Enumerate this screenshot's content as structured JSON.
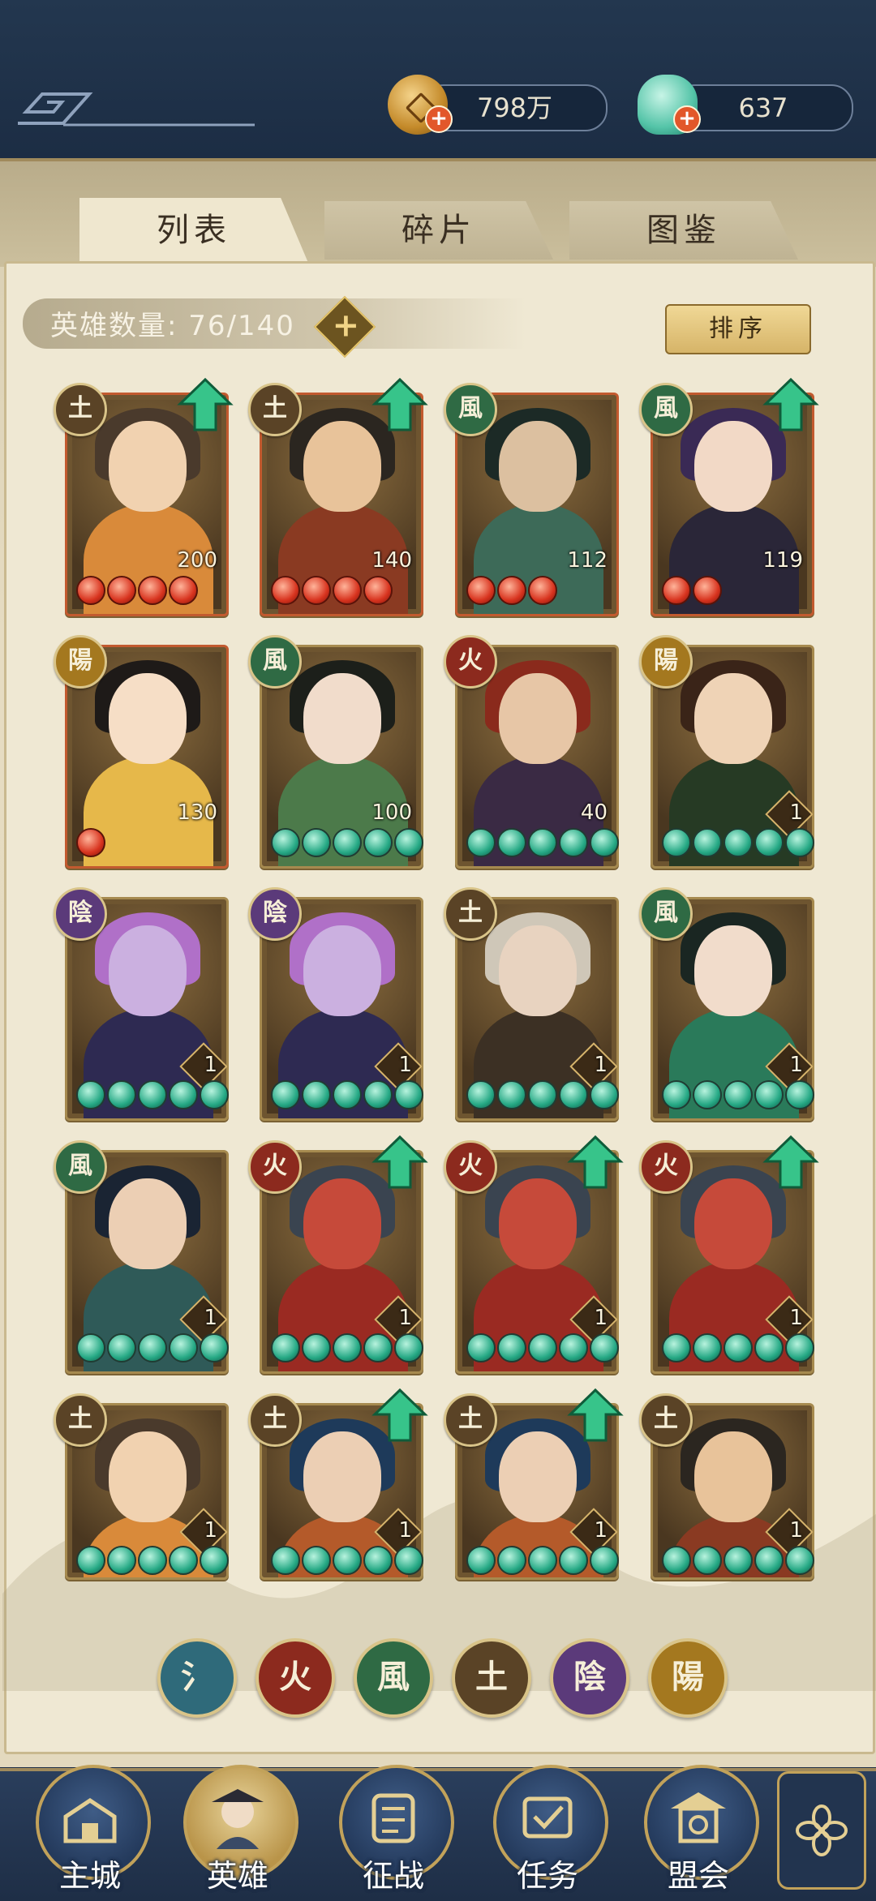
{
  "currency": {
    "coin": {
      "value": "798万",
      "icon": "copper-coin-icon"
    },
    "shell": {
      "value": "637",
      "icon": "jade-shell-icon"
    }
  },
  "tabs": [
    {
      "label": "列表",
      "active": true
    },
    {
      "label": "碎片",
      "active": false
    },
    {
      "label": "图鉴",
      "active": false
    }
  ],
  "hero_count": {
    "label": "英雄数量:",
    "value": "76/140"
  },
  "sort_button": "排序",
  "element_glyphs": {
    "water": "氵",
    "fire": "火",
    "wind": "風",
    "earth": "土",
    "yin": "陰",
    "yang": "陽"
  },
  "heroes": [
    {
      "element": "earth",
      "level": "200",
      "stars": 4,
      "orb": "red",
      "upgrade": true
    },
    {
      "element": "earth",
      "level": "140",
      "stars": 4,
      "orb": "red",
      "upgrade": true
    },
    {
      "element": "wind",
      "level": "112",
      "stars": 3,
      "orb": "red",
      "upgrade": false
    },
    {
      "element": "wind",
      "level": "119",
      "stars": 2,
      "orb": "red",
      "upgrade": true
    },
    {
      "element": "yang",
      "level": "130",
      "stars": 1,
      "orb": "red",
      "upgrade": false
    },
    {
      "element": "wind",
      "level": "100",
      "stars": 5,
      "orb": "green",
      "upgrade": false
    },
    {
      "element": "fire",
      "level": "40",
      "stars": 5,
      "orb": "green",
      "upgrade": false
    },
    {
      "element": "yang",
      "level": "1",
      "stars": 5,
      "orb": "green",
      "upgrade": false
    },
    {
      "element": "yin",
      "level": "1",
      "stars": 5,
      "orb": "green",
      "upgrade": false
    },
    {
      "element": "yin",
      "level": "1",
      "stars": 5,
      "orb": "green",
      "upgrade": false
    },
    {
      "element": "earth",
      "level": "1",
      "stars": 5,
      "orb": "green",
      "upgrade": false
    },
    {
      "element": "wind",
      "level": "1",
      "stars": 5,
      "orb": "green",
      "upgrade": false
    },
    {
      "element": "wind",
      "level": "1",
      "stars": 5,
      "orb": "green",
      "upgrade": false
    },
    {
      "element": "fire",
      "level": "1",
      "stars": 5,
      "orb": "green",
      "upgrade": true
    },
    {
      "element": "fire",
      "level": "1",
      "stars": 5,
      "orb": "green",
      "upgrade": true
    },
    {
      "element": "fire",
      "level": "1",
      "stars": 5,
      "orb": "green",
      "upgrade": true
    },
    {
      "element": "earth",
      "level": "1",
      "stars": 5,
      "orb": "green",
      "upgrade": false
    },
    {
      "element": "earth",
      "level": "1",
      "stars": 5,
      "orb": "green",
      "upgrade": true
    },
    {
      "element": "earth",
      "level": "1",
      "stars": 5,
      "orb": "green",
      "upgrade": true
    },
    {
      "element": "earth",
      "level": "1",
      "stars": 5,
      "orb": "green",
      "upgrade": false
    }
  ],
  "element_filters": [
    {
      "element": "water",
      "glyph": "氵"
    },
    {
      "element": "fire",
      "glyph": "火"
    },
    {
      "element": "wind",
      "glyph": "風"
    },
    {
      "element": "earth",
      "glyph": "土"
    },
    {
      "element": "yin",
      "glyph": "陰"
    },
    {
      "element": "yang",
      "glyph": "陽"
    }
  ],
  "element_colors": {
    "water": "#2f6a7a",
    "fire": "#8c2a1e",
    "wind": "#2f6a44",
    "earth": "#5a4326",
    "yin": "#5b3a7a",
    "yang": "#a4781f"
  },
  "nav": [
    {
      "label": "主城",
      "icon": "city-gate-icon",
      "active": false
    },
    {
      "label": "英雄",
      "icon": "hero-portrait-icon",
      "active": true
    },
    {
      "label": "征战",
      "icon": "battle-scroll-icon",
      "active": false
    },
    {
      "label": "任务",
      "icon": "task-scroll-icon",
      "active": false
    },
    {
      "label": "盟会",
      "icon": "alliance-pavilion-icon",
      "active": false
    }
  ],
  "menu_icon": "four-petal-menu-icon"
}
